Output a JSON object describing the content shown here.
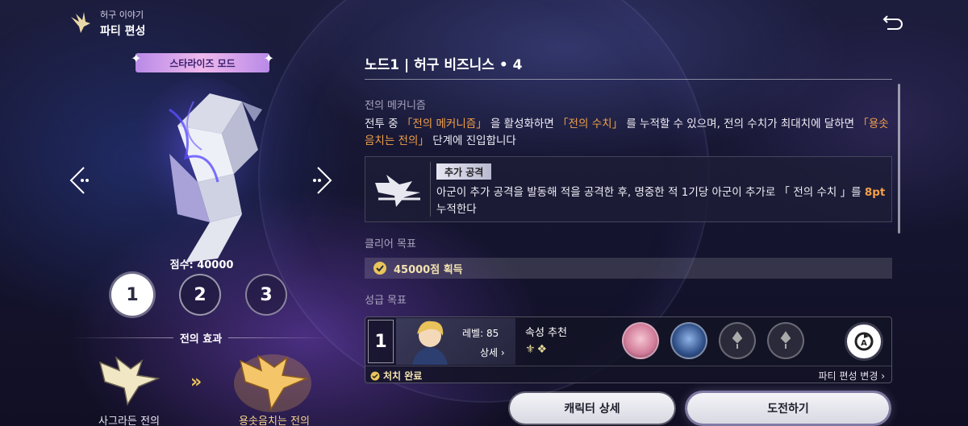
{
  "header": {
    "subtitle": "허구 이야기",
    "title": "파티 편성"
  },
  "left": {
    "mode_badge": "스타라이즈 모드",
    "score": "점수: 40000",
    "stages": [
      "1",
      "2",
      "3"
    ],
    "effect_title": "전의 효과",
    "effect_from": "사그라든 전의",
    "effect_to": "용솟음치는 전의"
  },
  "node": {
    "title": "노드1 | 허구 비즈니스 • 4",
    "mechanism_label": "전의 메커니즘",
    "mechanism_desc": {
      "p1": "전투 중 ",
      "h1": "「전의 메커니즘」",
      "p2": " 을 활성화하면 ",
      "h2": "「전의 수치」",
      "p3": " 를 누적할 수 있으며, 전의 수치가 최대치에 달하면 ",
      "h3": "「용솟음치는 전의」",
      "p4": " 단계에 진입합니다"
    },
    "extra": {
      "tag": "추가 공격",
      "text_a": "아군이 추가 공격을 발동해 적을 공격한 후, 명중한 적 1기당 아군이 추가로 「 전의 수치 」를 ",
      "text_value": "8pt",
      "text_b": " 누적한다"
    },
    "clear_label": "클리어 목표",
    "clear_goal": "45000점 획득",
    "star_label": "성급 목표"
  },
  "party": {
    "number": "1",
    "level": "레벨: 85",
    "detail": "상세 ›",
    "attr_label": "속성 추천",
    "attr_icons": "⚜❖",
    "clear_status": "처치 완료",
    "edit": "파티 편성 변경 ›"
  },
  "buttons": {
    "detail": "캐릭터 상세",
    "challenge": "도전하기"
  },
  "colors": {
    "highlight": "#f3a04a",
    "gold": "#e9c55b",
    "badge": "#b88ae8"
  }
}
